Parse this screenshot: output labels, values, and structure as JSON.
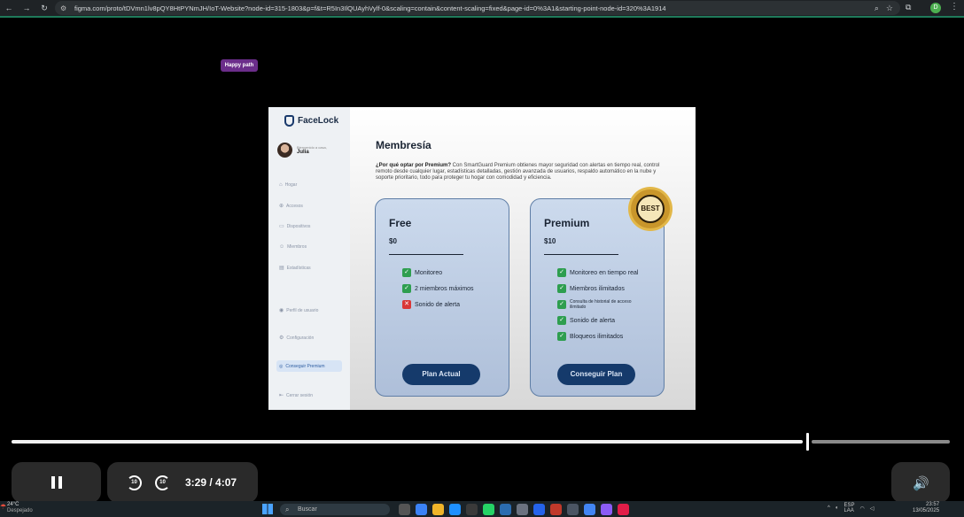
{
  "browser": {
    "url": "figma.com/proto/tDVmn1lv8pQY8HtPYNmJH/IoT-Website?node-id=315-1803&p=f&t=R5In3IlQUAyhVylf-0&scaling=contain&content-scaling=fixed&page-id=0%3A1&starting-point-node-id=320%3A1914",
    "profile_initial": "D",
    "icons": [
      "back-icon",
      "forward-icon",
      "reload-icon",
      "zoom-icon",
      "star-icon",
      "extensions-icon",
      "menu-icon"
    ]
  },
  "prototype": {
    "flow_badge": "Happy path",
    "app": {
      "logo": "FaceLock",
      "greeting": "Bienvenido a casa,",
      "user_name": "Julia",
      "sidebar": [
        {
          "label": "Hogar",
          "icon": "home-icon"
        },
        {
          "label": "Accesos",
          "icon": "key-icon"
        },
        {
          "label": "Dispositivos",
          "icon": "devices-icon"
        },
        {
          "label": "Miembros",
          "icon": "members-icon"
        },
        {
          "label": "Estadísticas",
          "icon": "chart-icon"
        },
        {
          "label": "Perfil de usuario",
          "icon": "user-icon"
        },
        {
          "label": "Configuración",
          "icon": "gear-icon"
        },
        {
          "label": "Conseguir Premium",
          "icon": "premium-icon"
        },
        {
          "label": "Cerrar sesión",
          "icon": "logout-icon"
        }
      ],
      "title": "Membresía",
      "desc_bold": "¿Por qué optar por Premium?",
      "desc_text": " Con SmartGuard Premium obtienes mayor seguridad con alertas en tiempo real, control remoto desde cualquier lugar, estadísticas detalladas, gestión avanzada de usuarios, respaldo automático en la nube y soporte prioritario, todo para proteger tu hogar con comodidad y eficiencia.",
      "plans": [
        {
          "name": "Free",
          "price": "$0",
          "features": [
            {
              "text": "Monitoreo",
              "included": true
            },
            {
              "text": "2 miembros máximos",
              "included": true
            },
            {
              "text": "Sonido de alerta",
              "included": false
            }
          ],
          "button": "Plan Actual"
        },
        {
          "name": "Premium",
          "price": "$10",
          "features": [
            {
              "text": "Monitoreo en tiempo real",
              "included": true
            },
            {
              "text": "Miembros ilimitados",
              "included": true
            },
            {
              "text": "Consulta de historial de acceso ilimitado",
              "included": true,
              "small": true
            },
            {
              "text": "Sonido de alerta",
              "included": true
            },
            {
              "text": "Bloqueos ilimitados",
              "included": true
            }
          ],
          "button": "Conseguir Plan"
        }
      ],
      "best_badge": "BEST"
    }
  },
  "player": {
    "current_time": "3:29",
    "duration": "4:07",
    "time_display": "3:29  /  4:07",
    "progress_fraction": 0.847,
    "skip_back_seconds": "10",
    "skip_forward_seconds": "10"
  },
  "taskbar": {
    "weather_temp": "24°C",
    "weather_desc": "Despejado",
    "search_placeholder": "Buscar",
    "lang": "ESP",
    "lang_sub": "LAA",
    "time": "23:57",
    "date": "13/05/2025"
  }
}
